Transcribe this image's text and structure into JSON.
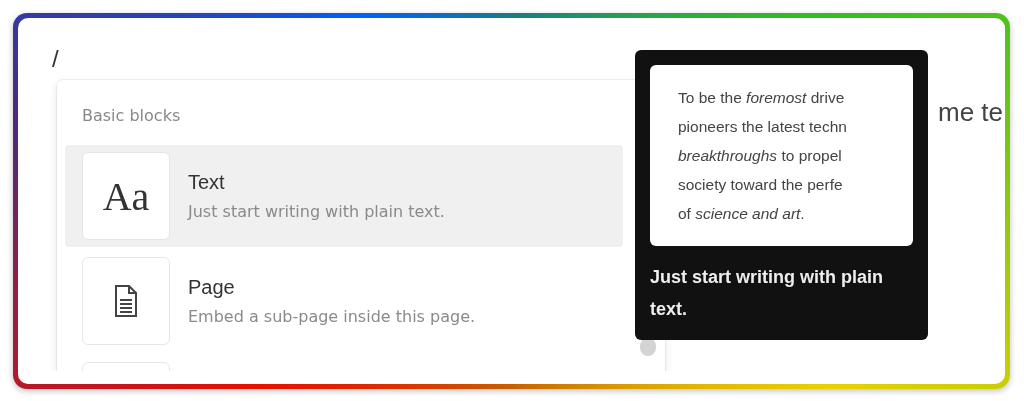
{
  "editor": {
    "lines": [
      "/"
    ],
    "trailing_text": "me te"
  },
  "menu": {
    "section_title": "Basic blocks",
    "items": [
      {
        "kind": "letters",
        "icon_text": "Aa",
        "title": "Text",
        "description": "Just start writing with plain text.",
        "selected": true
      },
      {
        "kind": "page",
        "title": "Page",
        "description": "Embed a sub-page inside this page.",
        "selected": false
      },
      {
        "kind": "blank",
        "selected": false
      }
    ]
  },
  "tooltip": {
    "preview_lines": [
      "To be the *foremost* drive",
      "pioneers the latest techn",
      "*breakthroughs* to propel",
      "society toward the perfe",
      "of *science and art*."
    ],
    "caption": "Just start writing with plain text."
  }
}
